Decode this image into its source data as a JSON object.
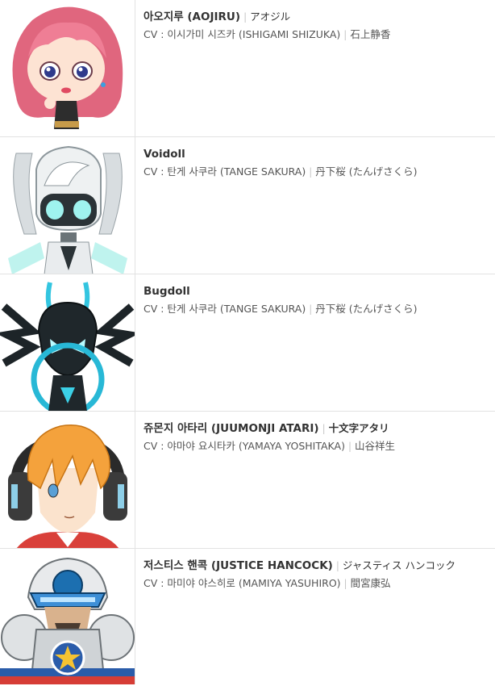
{
  "characters": [
    {
      "name": "아오지루 (AOJIRU)",
      "jp": "アオジル",
      "cv": "CV : 이시가미 시즈카 (ISHIGAMI SHIZUKA)",
      "cv_jp": "石上静香",
      "image": "pink-haired-girl-portrait"
    },
    {
      "name": "Voidoll",
      "jp": "",
      "cv": "CV : 탄게 사쿠라 (TANGE SAKURA)",
      "cv_jp": "丹下桜 (たんげさくら)",
      "image": "white-robot-doll-portrait"
    },
    {
      "name": "Bugdoll",
      "jp": "",
      "cv": "CV : 탄게 사쿠라 (TANGE SAKURA)",
      "cv_jp": "丹下桜 (たんげさくら)",
      "image": "dark-robot-doll-portrait"
    },
    {
      "name": "쥬몬지 아타리 (JUUMONJI ATARI)",
      "jp": "十文字アタリ",
      "cv": "CV : 야마야 요시타카 (YAMAYA YOSHITAKA)",
      "cv_jp": "山谷祥生",
      "image": "orange-haired-boy-portrait"
    },
    {
      "name": "저스티스 핸콕 (JUSTICE HANCOCK)",
      "jp": "ジャスティス ハンコック",
      "cv": "CV : 마미야 야스히로 (MAMIYA YASUHIRO)",
      "cv_jp": "間宮康弘",
      "image": "armored-hero-portrait"
    }
  ],
  "colors": {
    "separator": "#c8c8c8",
    "border": "#e2e2e2",
    "text": "#333333"
  }
}
